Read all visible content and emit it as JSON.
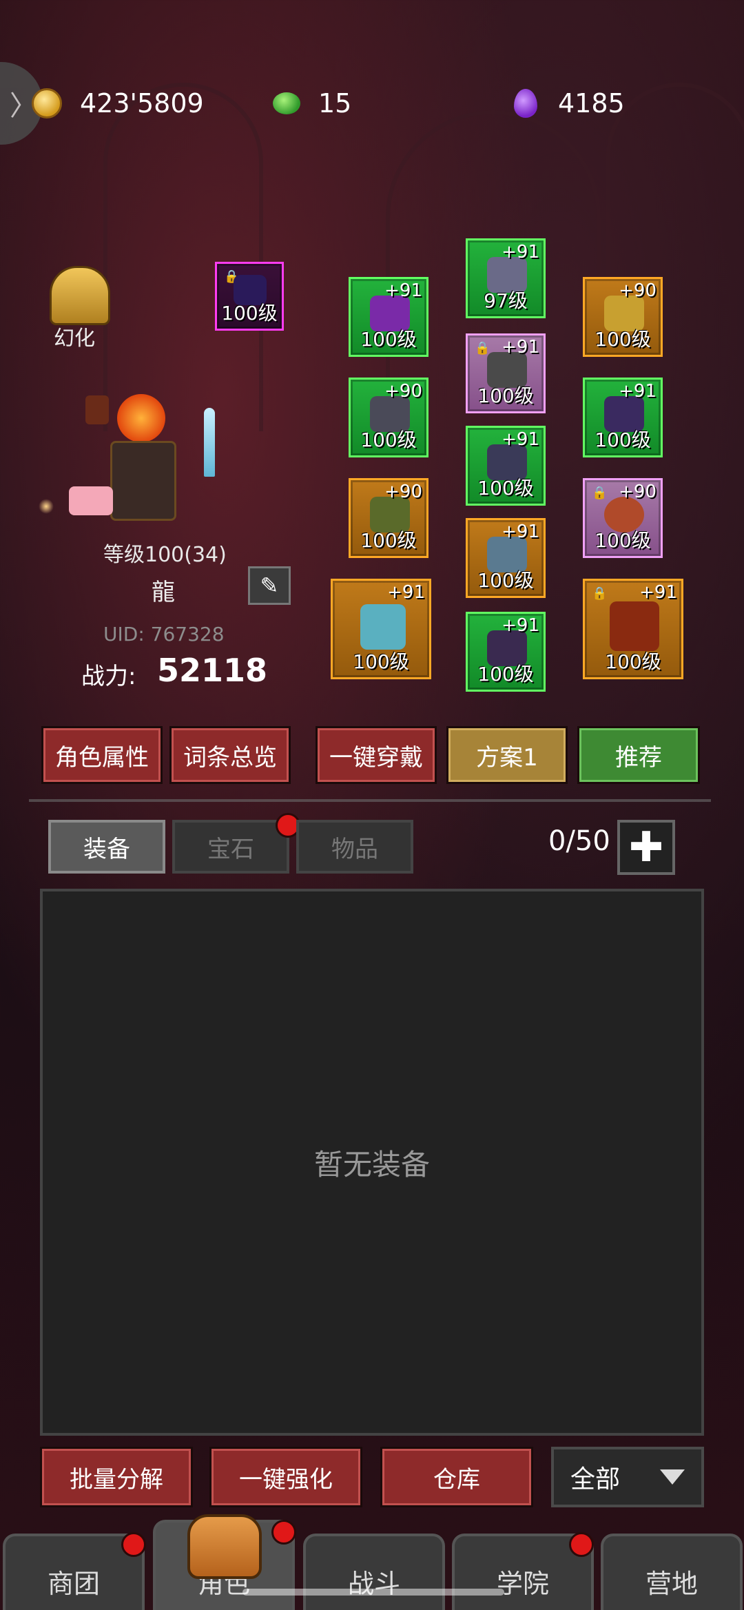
{
  "currencies": {
    "gold": "423'5809",
    "green_gem": "15",
    "purple_drop": "4185"
  },
  "side_button_glyph": "〉",
  "character": {
    "skin_label": "幻化",
    "level_text": "等级100(34)",
    "name": "龍",
    "uid_text": "UID: 767328",
    "power_label": "战力:",
    "power_value": "52118",
    "edit_glyph": "✎"
  },
  "equipment": [
    {
      "plus": "",
      "level": "100级",
      "locked": true
    },
    {
      "plus": "+91",
      "level": "100级",
      "locked": false
    },
    {
      "plus": "+90",
      "level": "100级",
      "locked": false
    },
    {
      "plus": "+90",
      "level": "100级",
      "locked": false
    },
    {
      "plus": "+91",
      "level": "100级",
      "locked": false
    },
    {
      "plus": "+91",
      "level": "97级",
      "locked": false
    },
    {
      "plus": "+91",
      "level": "100级",
      "locked": true
    },
    {
      "plus": "+91",
      "level": "100级",
      "locked": false
    },
    {
      "plus": "+91",
      "level": "100级",
      "locked": false
    },
    {
      "plus": "+91",
      "level": "100级",
      "locked": false
    },
    {
      "plus": "+90",
      "level": "100级",
      "locked": false
    },
    {
      "plus": "+91",
      "level": "100级",
      "locked": false
    },
    {
      "plus": "+90",
      "level": "100级",
      "locked": true
    },
    {
      "plus": "+91",
      "level": "100级",
      "locked": true
    }
  ],
  "lock_glyph": "🔒",
  "actions": {
    "attributes": "角色属性",
    "affix_overview": "词条总览",
    "equip_all": "一键穿戴",
    "plan": "方案1",
    "recommend": "推荐"
  },
  "tabs": {
    "equipment": "装备",
    "gems": "宝石",
    "items": "物品"
  },
  "capacity": "0/50",
  "add_glyph": "✚",
  "empty_text": "暂无装备",
  "bottom_actions": {
    "batch_dismantle": "批量分解",
    "enhance_all": "一键强化",
    "warehouse": "仓库",
    "filter": "全部"
  },
  "nav": {
    "guild": "商团",
    "character": "角色",
    "battle": "战斗",
    "academy": "学院",
    "camp": "营地"
  }
}
